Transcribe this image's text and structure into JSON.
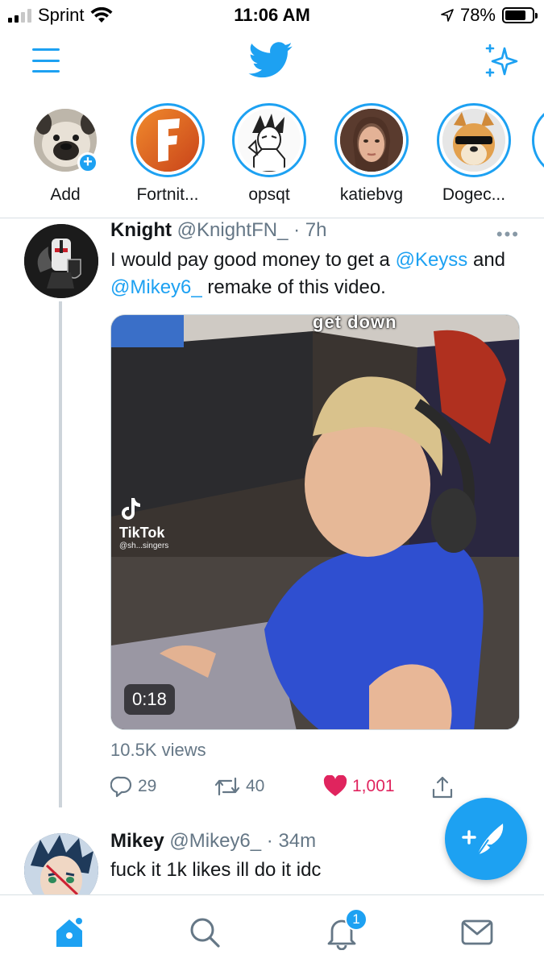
{
  "status_bar": {
    "carrier": "Sprint",
    "time": "11:06 AM",
    "battery_percent": "78%",
    "battery_level": 0.78,
    "signal_bars": 2
  },
  "top_nav": {
    "menu_icon": "hamburger-icon",
    "logo_icon": "twitter-bird-icon",
    "sparkle_icon": "sparkle-icon"
  },
  "fleets": [
    {
      "label": "Add",
      "kind": "add"
    },
    {
      "label": "Fortnit...",
      "kind": "fleet"
    },
    {
      "label": "opsqt",
      "kind": "fleet"
    },
    {
      "label": "katiebvg",
      "kind": "fleet"
    },
    {
      "label": "Dogec...",
      "kind": "fleet"
    }
  ],
  "tweet": {
    "name": "Knight",
    "handle": "@KnightFN_",
    "time": "· 7h",
    "more": "•••",
    "text_before": "I would pay good money to get a ",
    "mention1": "@Keyss",
    "text_mid": " and ",
    "mention2": "@Mikey6_",
    "text_after": " remake of this video.",
    "media": {
      "duration": "0:18",
      "caption_overlay": "get down",
      "watermark": "TikTok",
      "watermark_handle": "@sh...singers"
    },
    "views": "10.5K views",
    "actions": {
      "replies": "29",
      "retweets": "40",
      "likes": "1,001"
    }
  },
  "reply": {
    "name": "Mikey",
    "handle": "@Mikey6_",
    "time": "· 34m",
    "text": "fuck it 1k likes ill do it idc"
  },
  "bottom_nav": {
    "items": [
      "home-icon",
      "search-icon",
      "notifications-icon",
      "messages-icon"
    ],
    "notification_count": "1"
  },
  "colors": {
    "accent": "#1da1f2",
    "like": "#e0245e",
    "muted": "#657786"
  }
}
